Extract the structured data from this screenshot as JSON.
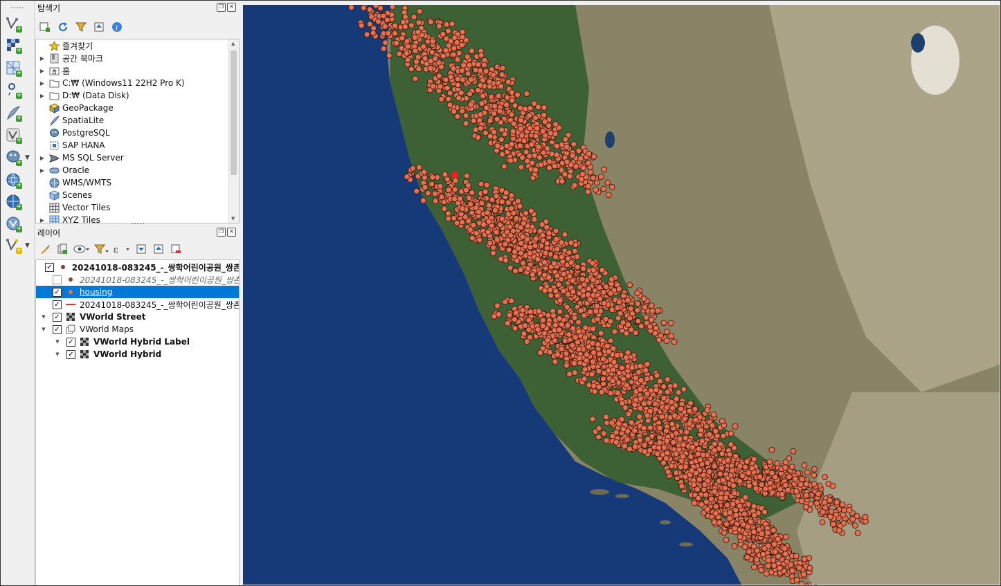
{
  "browser_panel": {
    "title": "탐색기",
    "toolbar_icons": [
      "add-selected-layers-icon",
      "refresh-icon",
      "filter-icon",
      "collapse-all-icon",
      "info-icon"
    ],
    "items": [
      {
        "label": "즐겨찾기",
        "icon": "star-icon",
        "expandable": false
      },
      {
        "label": "공간 북마크",
        "icon": "bookmark-icon",
        "expandable": true
      },
      {
        "label": "홈",
        "icon": "home-folder-icon",
        "expandable": true
      },
      {
        "label": "C:₩ (Windows11 22H2 Pro K)",
        "icon": "folder-icon",
        "expandable": true
      },
      {
        "label": "D:₩ (Data Disk)",
        "icon": "folder-icon",
        "expandable": true
      },
      {
        "label": "GeoPackage",
        "icon": "geopackage-icon",
        "expandable": false
      },
      {
        "label": "SpatiaLite",
        "icon": "spatialite-icon",
        "expandable": false
      },
      {
        "label": "PostgreSQL",
        "icon": "postgresql-icon",
        "expandable": false
      },
      {
        "label": "SAP HANA",
        "icon": "sap-hana-icon",
        "expandable": false
      },
      {
        "label": "MS SQL Server",
        "icon": "mssql-icon",
        "expandable": true
      },
      {
        "label": "Oracle",
        "icon": "oracle-icon",
        "expandable": true
      },
      {
        "label": "WMS/WMTS",
        "icon": "wms-icon",
        "expandable": false
      },
      {
        "label": "Scenes",
        "icon": "scenes-icon",
        "expandable": false
      },
      {
        "label": "Vector Tiles",
        "icon": "vector-tiles-icon",
        "expandable": false
      },
      {
        "label": "XYZ Tiles",
        "icon": "xyz-tiles-icon",
        "expandable": true
      }
    ]
  },
  "layers_panel": {
    "title": "레이어",
    "toolbar_icons": [
      "style-icon",
      "add-group-icon",
      "manage-visibility-icon",
      "filter-legend-icon",
      "expression-filter-icon",
      "expand-all-icon",
      "collapse-all-icon",
      "remove-layer-icon"
    ],
    "layers": [
      {
        "name": "20241018-083245_-_쌍학어린이공원_쌍촌",
        "checked": true,
        "symbol": "point",
        "symbol_color": "#8b3a3a",
        "style": "bold",
        "selected": false,
        "expand": false,
        "indent": 0
      },
      {
        "name": "20241018-083245_-_쌍학어린이공원_쌍촌",
        "checked": false,
        "symbol": "point",
        "symbol_color": "#8b4a2a",
        "style": "italic-grey",
        "selected": false,
        "expand": false,
        "indent": 0
      },
      {
        "name": "housing",
        "checked": true,
        "symbol": "point",
        "symbol_color": "#e8704f",
        "style": "underline",
        "selected": true,
        "expand": false,
        "indent": 0
      },
      {
        "name": "20241018-083245_-_쌍학어린이공원_쌍촌",
        "checked": true,
        "symbol": "line",
        "symbol_color": "#e03030",
        "style": "normal",
        "selected": false,
        "expand": false,
        "indent": 0
      },
      {
        "name": "VWorld Street",
        "checked": true,
        "symbol": "raster",
        "symbol_color": "#333333",
        "style": "bold",
        "selected": false,
        "expand": true,
        "indent": 0
      },
      {
        "name": "VWorld Maps",
        "checked": true,
        "symbol": "group",
        "symbol_color": "#666666",
        "style": "normal",
        "selected": false,
        "expand": true,
        "indent": 0
      },
      {
        "name": "VWorld Hybrid Label",
        "checked": true,
        "symbol": "raster",
        "symbol_color": "#333333",
        "style": "bold",
        "selected": false,
        "expand": true,
        "indent": 1
      },
      {
        "name": "VWorld Hybrid",
        "checked": true,
        "symbol": "raster",
        "symbol_color": "#333333",
        "style": "bold",
        "selected": false,
        "expand": true,
        "indent": 1
      }
    ]
  },
  "vertical_toolbar": {
    "icons": [
      "add-vector-layer-icon",
      "add-raster-layer-icon",
      "add-mesh-layer-icon",
      "add-delimited-text-icon",
      "add-spatialite-icon",
      "add-virtual-layer-icon",
      "add-postgis-icon",
      "add-wms-icon",
      "add-wfs-icon",
      "add-wcs-icon",
      "new-layer-icon"
    ]
  },
  "map_canvas": {
    "layer_point_color": "#e8704f",
    "point_outline_color": "#3a1e12",
    "highlight_point_color": "#ff1a1a",
    "ocean_color": "#163a78",
    "land_colors": [
      "#2f5a2c",
      "#8a8466",
      "#c7bfa6"
    ]
  }
}
